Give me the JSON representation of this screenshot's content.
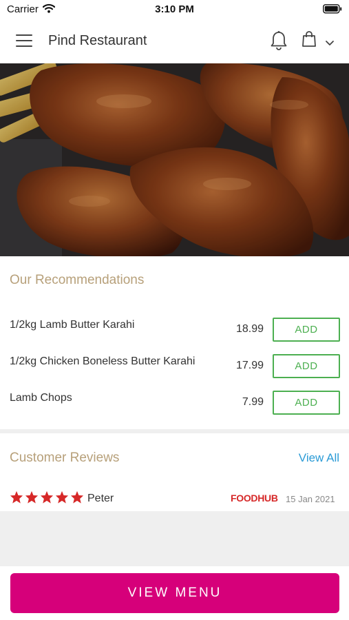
{
  "status": {
    "carrier": "Carrier",
    "time": "3:10 PM"
  },
  "header": {
    "title": "Pind Restaurant",
    "icons": [
      "menu-icon",
      "bell-icon",
      "shopping-bag-icon",
      "chevron-down-icon"
    ]
  },
  "recommendations": {
    "title": "Our Recommendations",
    "add_label": "ADD",
    "items": [
      {
        "name": "1/2kg Lamb Butter Karahi",
        "price": "18.99"
      },
      {
        "name": "1/2kg Chicken Boneless Butter Karahi",
        "price": "17.99"
      },
      {
        "name": "Lamb Chops",
        "price": "7.99"
      }
    ]
  },
  "reviews": {
    "title": "Customer Reviews",
    "view_all": "View All",
    "items": [
      {
        "reviewer": "Peter",
        "rating": 5,
        "source": "FOODHUB",
        "date": "15 Jan 2021"
      }
    ]
  },
  "footer": {
    "view_menu": "VIEW MENU"
  },
  "colors": {
    "accent": "#d6007a",
    "section_title": "#b7a07a",
    "add_button": "#4caf50",
    "link": "#2b9bd6",
    "star": "#d62828"
  }
}
